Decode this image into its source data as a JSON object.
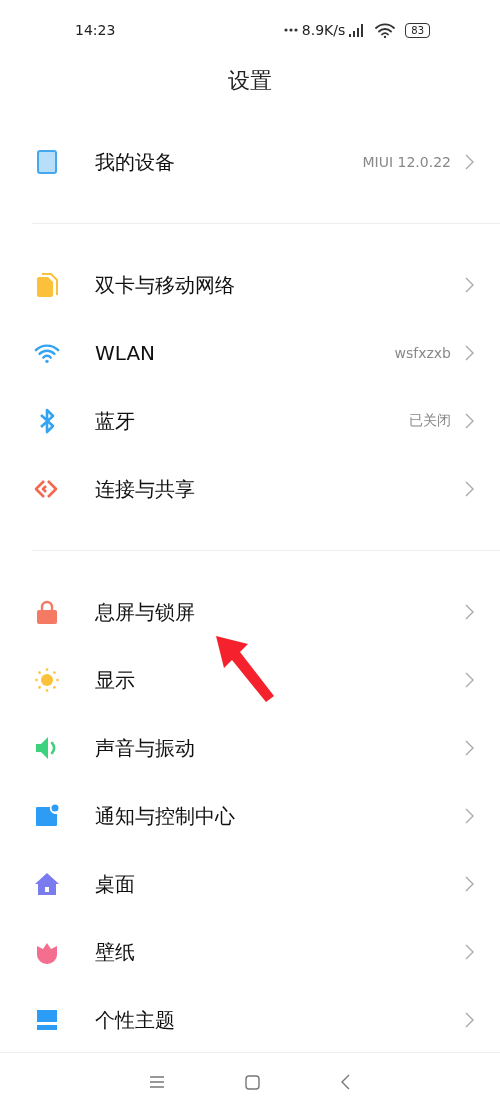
{
  "status_bar": {
    "time": "14:23",
    "speed": "8.9K/s",
    "battery": "83"
  },
  "title": "设置",
  "sections": [
    {
      "items": [
        {
          "kind": "device",
          "label": "我的设备",
          "value": "MIUI 12.0.22"
        }
      ]
    },
    {
      "items": [
        {
          "kind": "sim",
          "label": "双卡与移动网络"
        },
        {
          "kind": "wifi",
          "label": "WLAN",
          "value": "wsfxzxb"
        },
        {
          "kind": "bluetooth",
          "label": "蓝牙",
          "value": "已关闭"
        },
        {
          "kind": "share",
          "label": "连接与共享"
        }
      ]
    },
    {
      "items": [
        {
          "kind": "lock",
          "label": "息屏与锁屏"
        },
        {
          "kind": "sun",
          "label": "显示"
        },
        {
          "kind": "sound",
          "label": "声音与振动"
        },
        {
          "kind": "notify",
          "label": "通知与控制中心"
        },
        {
          "kind": "home",
          "label": "桌面"
        },
        {
          "kind": "tulip",
          "label": "壁纸"
        },
        {
          "kind": "theme",
          "label": "个性主题"
        }
      ]
    }
  ],
  "annotation": {
    "kind": "arrow",
    "color": "#f5222d"
  }
}
